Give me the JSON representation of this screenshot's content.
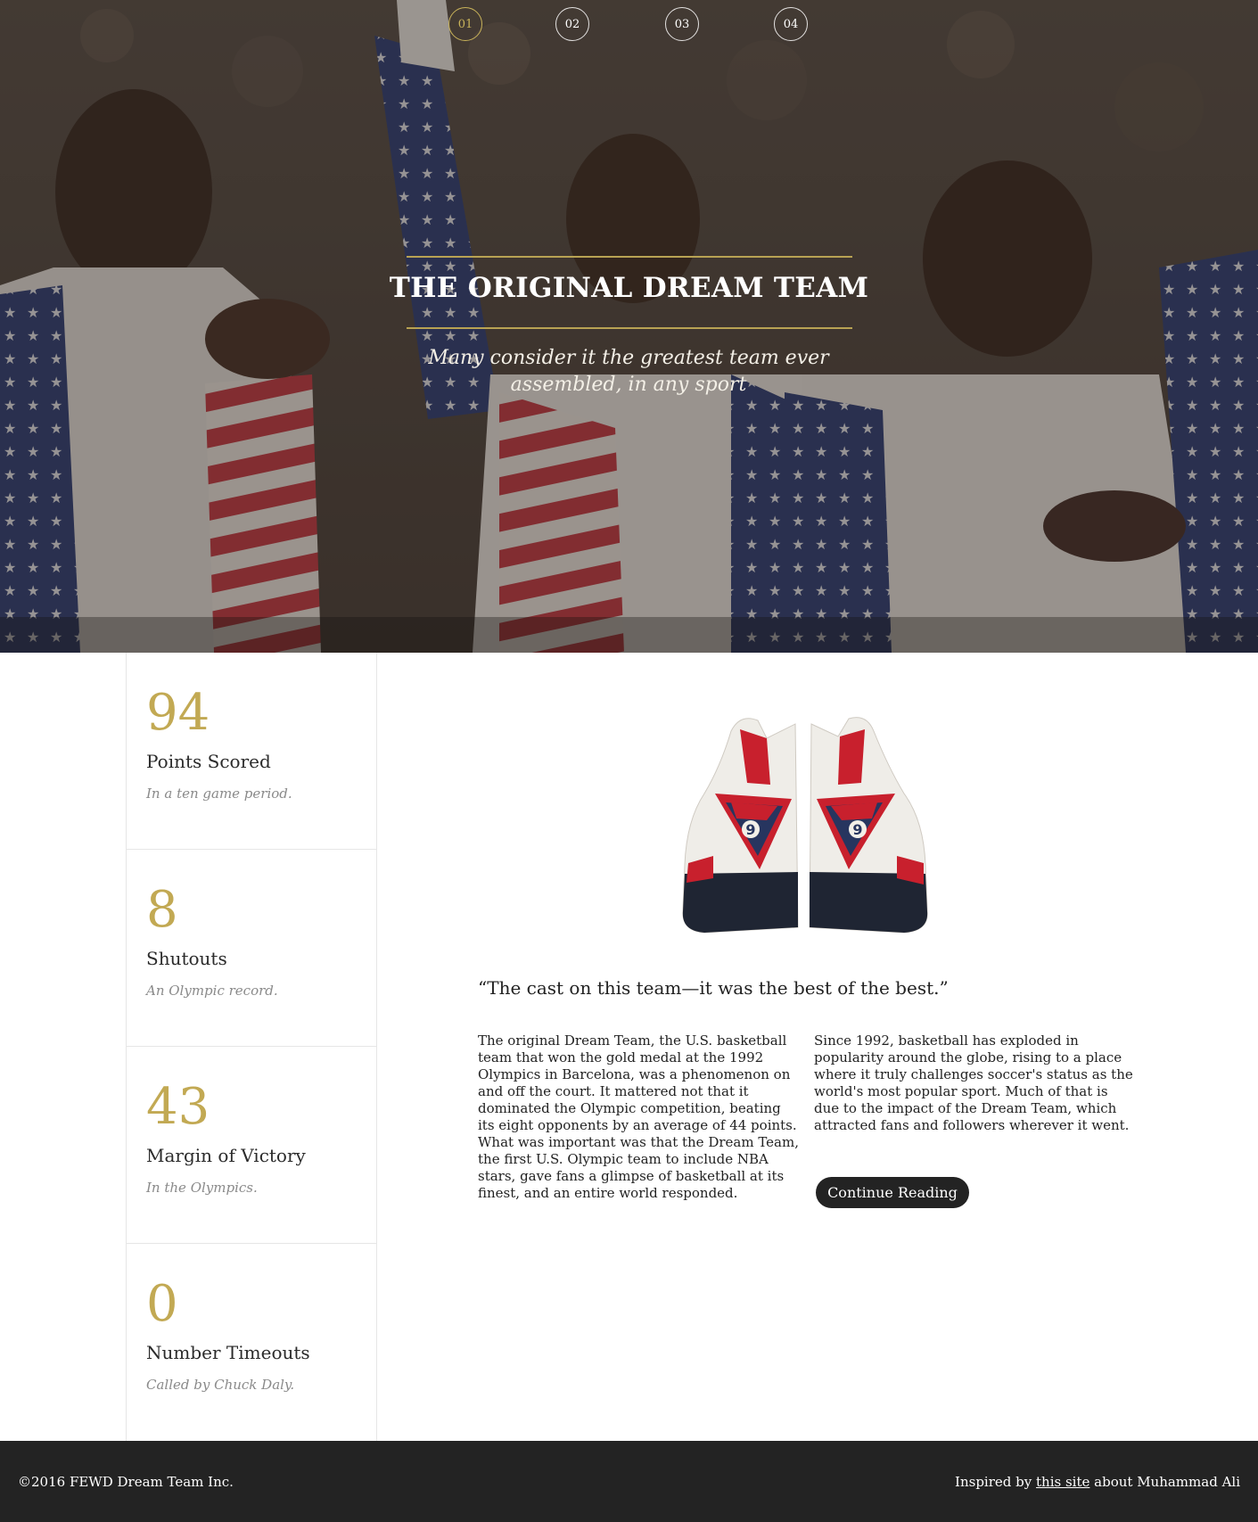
{
  "hero": {
    "nav": [
      "01",
      "02",
      "03",
      "04"
    ],
    "active_index": 0,
    "title": "THE ORIGINAL DREAM TEAM",
    "subtitle": "Many consider it the greatest team ever assembled, in any sport"
  },
  "stats": [
    {
      "value": "94",
      "label": "Points Scored",
      "note": "In a ten game period."
    },
    {
      "value": "8",
      "label": "Shutouts",
      "note": "An Olympic record."
    },
    {
      "value": "43",
      "label": "Margin of Victory",
      "note": "In the Olympics."
    },
    {
      "value": "0",
      "label": "Number Timeouts",
      "note": "Called by Chuck Daly."
    }
  ],
  "article": {
    "sneaker_number": "9",
    "quote": "“The cast on this team—it was the best of the best.”",
    "paragraph_1": "The original Dream Team, the U.S. basketball team that won the gold medal at the 1992 Olympics in Barcelona, was a phenomenon on and off the court. It mattered not that it dominated the Olympic competition, beating its eight opponents by an average of 44 points. What was important was that the Dream Team, the first U.S. Olympic team to include NBA stars, gave fans a glimpse of basketball at its finest, and an entire world responded.",
    "paragraph_2": "Since 1992, basketball has exploded in popularity around the globe, rising to a place where it truly challenges soccer's status as the world's most popular sport. Much of that is due to the impact of the Dream Team, which attracted fans and followers wherever it went.",
    "cta_label": "Continue Reading"
  },
  "footer": {
    "copyright": "©2016 FEWD Dream Team Inc.",
    "inspired_prefix": "Inspired by",
    "inspired_link": "this site",
    "inspired_suffix": "about Muhammad Ali"
  },
  "colors": {
    "accent_gold": "#c2a953",
    "dark": "#232323",
    "muted_text": "#8a8a8a"
  },
  "icons": {
    "hero_image": "olympic-team-photo",
    "product_image": "sneaker-pair-image"
  }
}
